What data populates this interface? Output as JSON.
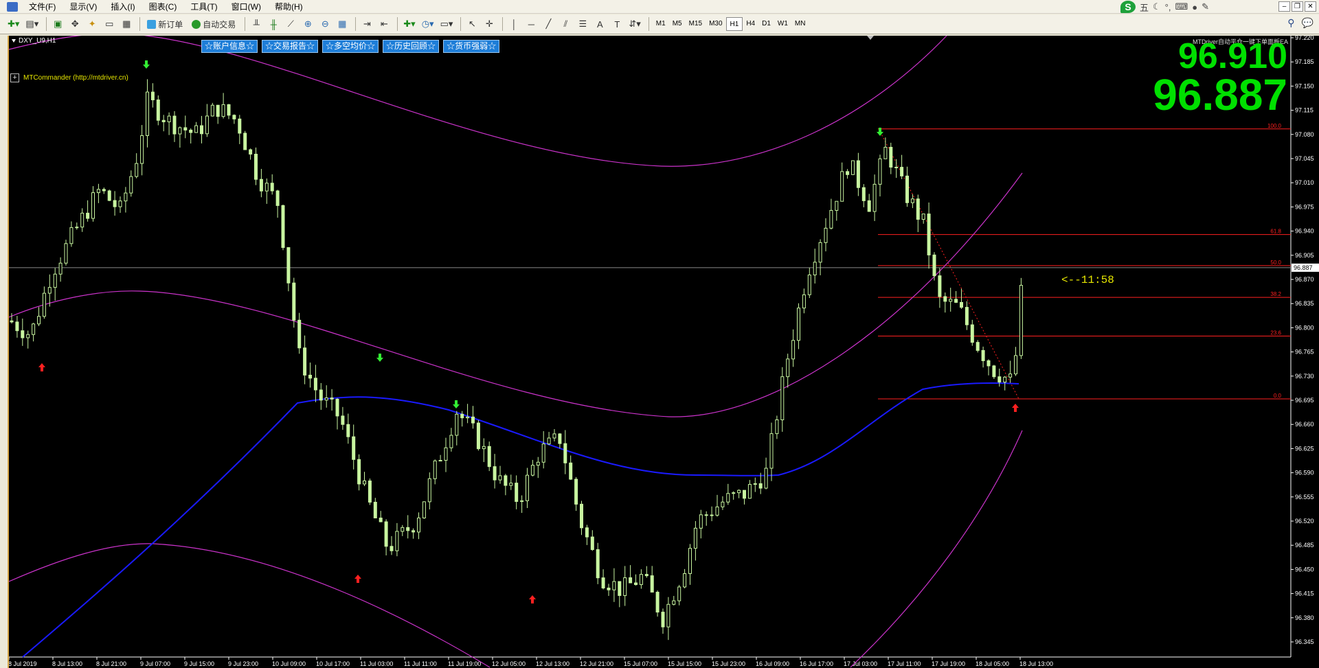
{
  "menu": {
    "items": [
      "文件(F)",
      "显示(V)",
      "插入(I)",
      "图表(C)",
      "工具(T)",
      "窗口(W)",
      "帮助(H)"
    ]
  },
  "tray": {
    "logo": "S",
    "ime": "五"
  },
  "toolbar": {
    "new_order": "新订单",
    "auto_trade": "自动交易",
    "timeframes": [
      "M1",
      "M5",
      "M15",
      "M30",
      "H1",
      "H4",
      "D1",
      "W1",
      "MN"
    ],
    "active_timeframe": "H1"
  },
  "chart": {
    "symbol_title": "DXY_U9,H1",
    "top_buttons": [
      "☆账户信息☆",
      "☆交易报告☆",
      "☆多空均价☆",
      "☆历史回顾☆",
      "☆货币强弱☆"
    ],
    "commander_label": "MTCommander (http://mtdriver.cn)",
    "ea_label": "MTDriver自动平仓一键下单面板EA",
    "bid_big": "96.910",
    "ask_big": "96.887",
    "countdown": "<--11:58",
    "current_price_label": "96.887",
    "price_axis": [
      "97.220",
      "97.185",
      "97.150",
      "97.115",
      "97.080",
      "97.045",
      "97.010",
      "96.975",
      "96.940",
      "96.905",
      "96.870",
      "96.835",
      "96.800",
      "96.765",
      "96.730",
      "96.695",
      "96.660",
      "96.625",
      "96.590",
      "96.555",
      "96.520",
      "96.485",
      "96.450",
      "96.415",
      "96.380",
      "96.345"
    ],
    "time_axis": [
      "8 Jul 2019",
      "8 Jul 13:00",
      "8 Jul 21:00",
      "9 Jul 07:00",
      "9 Jul 15:00",
      "9 Jul 23:00",
      "10 Jul 09:00",
      "10 Jul 17:00",
      "11 Jul 03:00",
      "11 Jul 11:00",
      "11 Jul 19:00",
      "12 Jul 05:00",
      "12 Jul 13:00",
      "12 Jul 21:00",
      "15 Jul 07:00",
      "15 Jul 15:00",
      "15 Jul 23:00",
      "16 Jul 09:00",
      "16 Jul 17:00",
      "17 Jul 03:00",
      "17 Jul 11:00",
      "17 Jul 19:00",
      "18 Jul 05:00",
      "18 Jul 13:00"
    ],
    "fib_labels": [
      "100.0",
      "61.8",
      "50.0",
      "38.2",
      "23.6",
      "0.0"
    ],
    "fib_levels": [
      97.088,
      96.935,
      96.89,
      96.844,
      96.788,
      96.697
    ],
    "colors": {
      "candle": "#c8f5a0",
      "ma": "#1a1aff",
      "channel": "#cc33cc",
      "fib": "#ff2020",
      "up_arrow": "#ff2020",
      "down_arrow": "#33ee33",
      "price_line": "#888888"
    }
  }
}
